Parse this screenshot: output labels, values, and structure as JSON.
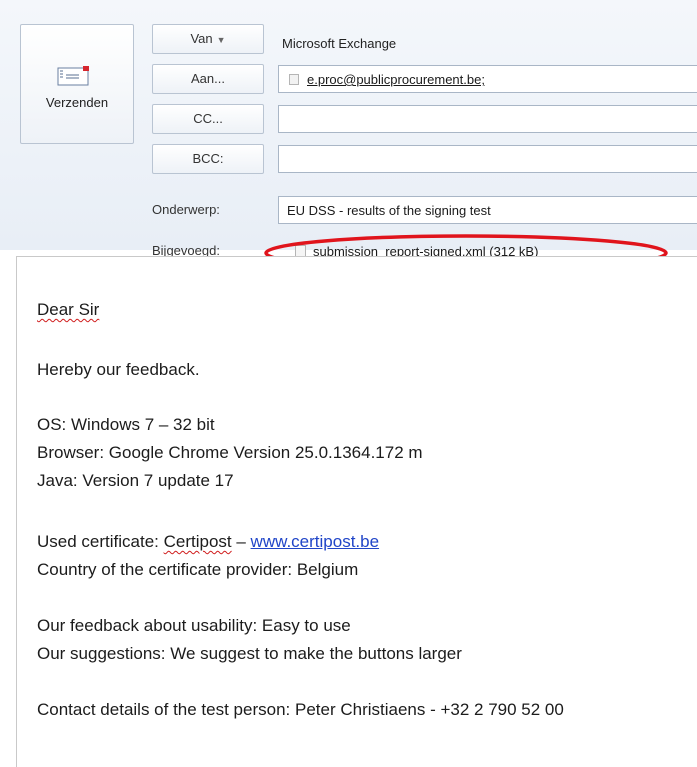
{
  "compose": {
    "send_label": "Verzenden",
    "from_button": "Van",
    "from_value": "Microsoft Exchange",
    "to_button": "Aan...",
    "to_value": "e.proc@publicprocurement.be;",
    "cc_button": "CC...",
    "cc_value": "",
    "bcc_button": "BCC:",
    "bcc_value": "",
    "subject_label": "Onderwerp:",
    "subject_value": "EU DSS - results of the signing test",
    "attached_label": "Bijgevoegd:",
    "attachment_name": "submission_report-signed.xml (312 kB)",
    "highlight_color": "#e0141c"
  },
  "message": {
    "greeting": "Dear Sir",
    "intro": "Hereby our feedback.",
    "os_line": "OS: Windows 7 – 32 bit",
    "browser_line": "Browser: Google Chrome Version 25.0.1364.172 m",
    "java_line": "Java: Version 7 update 17",
    "cert_prefix": "Used certificate: ",
    "cert_name": "Certipost",
    "cert_dash": " – ",
    "cert_link": "www.certipost.be",
    "country_line": "Country of the certificate provider: Belgium",
    "usability_line": "Our feedback about usability:  Easy to use",
    "suggestions_line": "Our suggestions: We suggest to make the buttons larger",
    "contact_line": "Contact details of the test person: Peter Christiaens - +32 2 790 52 00"
  }
}
